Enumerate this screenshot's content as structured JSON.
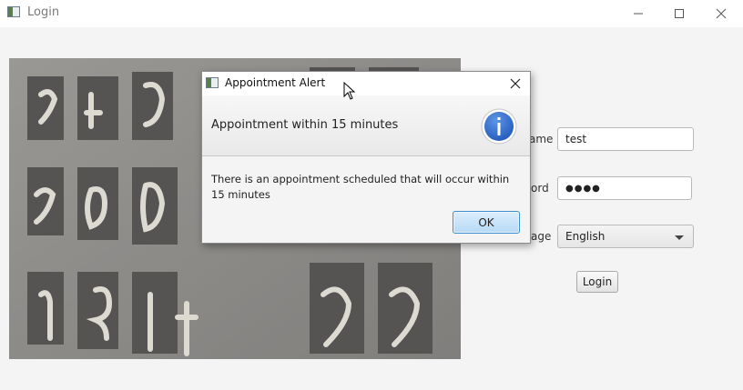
{
  "window": {
    "title": "Login"
  },
  "form": {
    "username_label_visible": "ame",
    "username_value": "test",
    "password_label_visible": "ord",
    "password_value": "●●●●",
    "language_label_visible": "age",
    "language_value": "English",
    "login_label": "Login"
  },
  "dialog": {
    "title": "Appointment Alert",
    "header": "Appointment within 15 minutes",
    "content": "There is an appointment scheduled that will occur within 15 minutes",
    "ok_label": "OK",
    "icon": "info-icon"
  },
  "colors": {
    "accent": "#2f6fc8",
    "ok_border": "#3f8fd0"
  }
}
